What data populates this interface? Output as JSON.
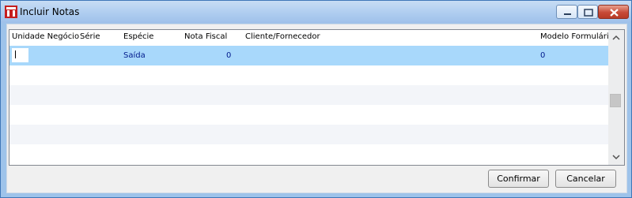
{
  "window": {
    "title": "Incluir Notas",
    "icon": "application-logo-icon"
  },
  "grid": {
    "columns": [
      "Unidade Negócio",
      "Série",
      "Espécie",
      "Nota Fiscal",
      "Cliente/Fornecedor",
      "Modelo Formulário"
    ],
    "rows": [
      {
        "unidade": "",
        "serie": "",
        "especie": "Saída",
        "nota_fiscal": "0",
        "cliente": "",
        "modelo": "0"
      }
    ]
  },
  "buttons": {
    "confirm": "Confirmar",
    "cancel": "Cancelar"
  },
  "colors": {
    "selected_row": "#a8d8fb",
    "text": "#001a8c"
  }
}
